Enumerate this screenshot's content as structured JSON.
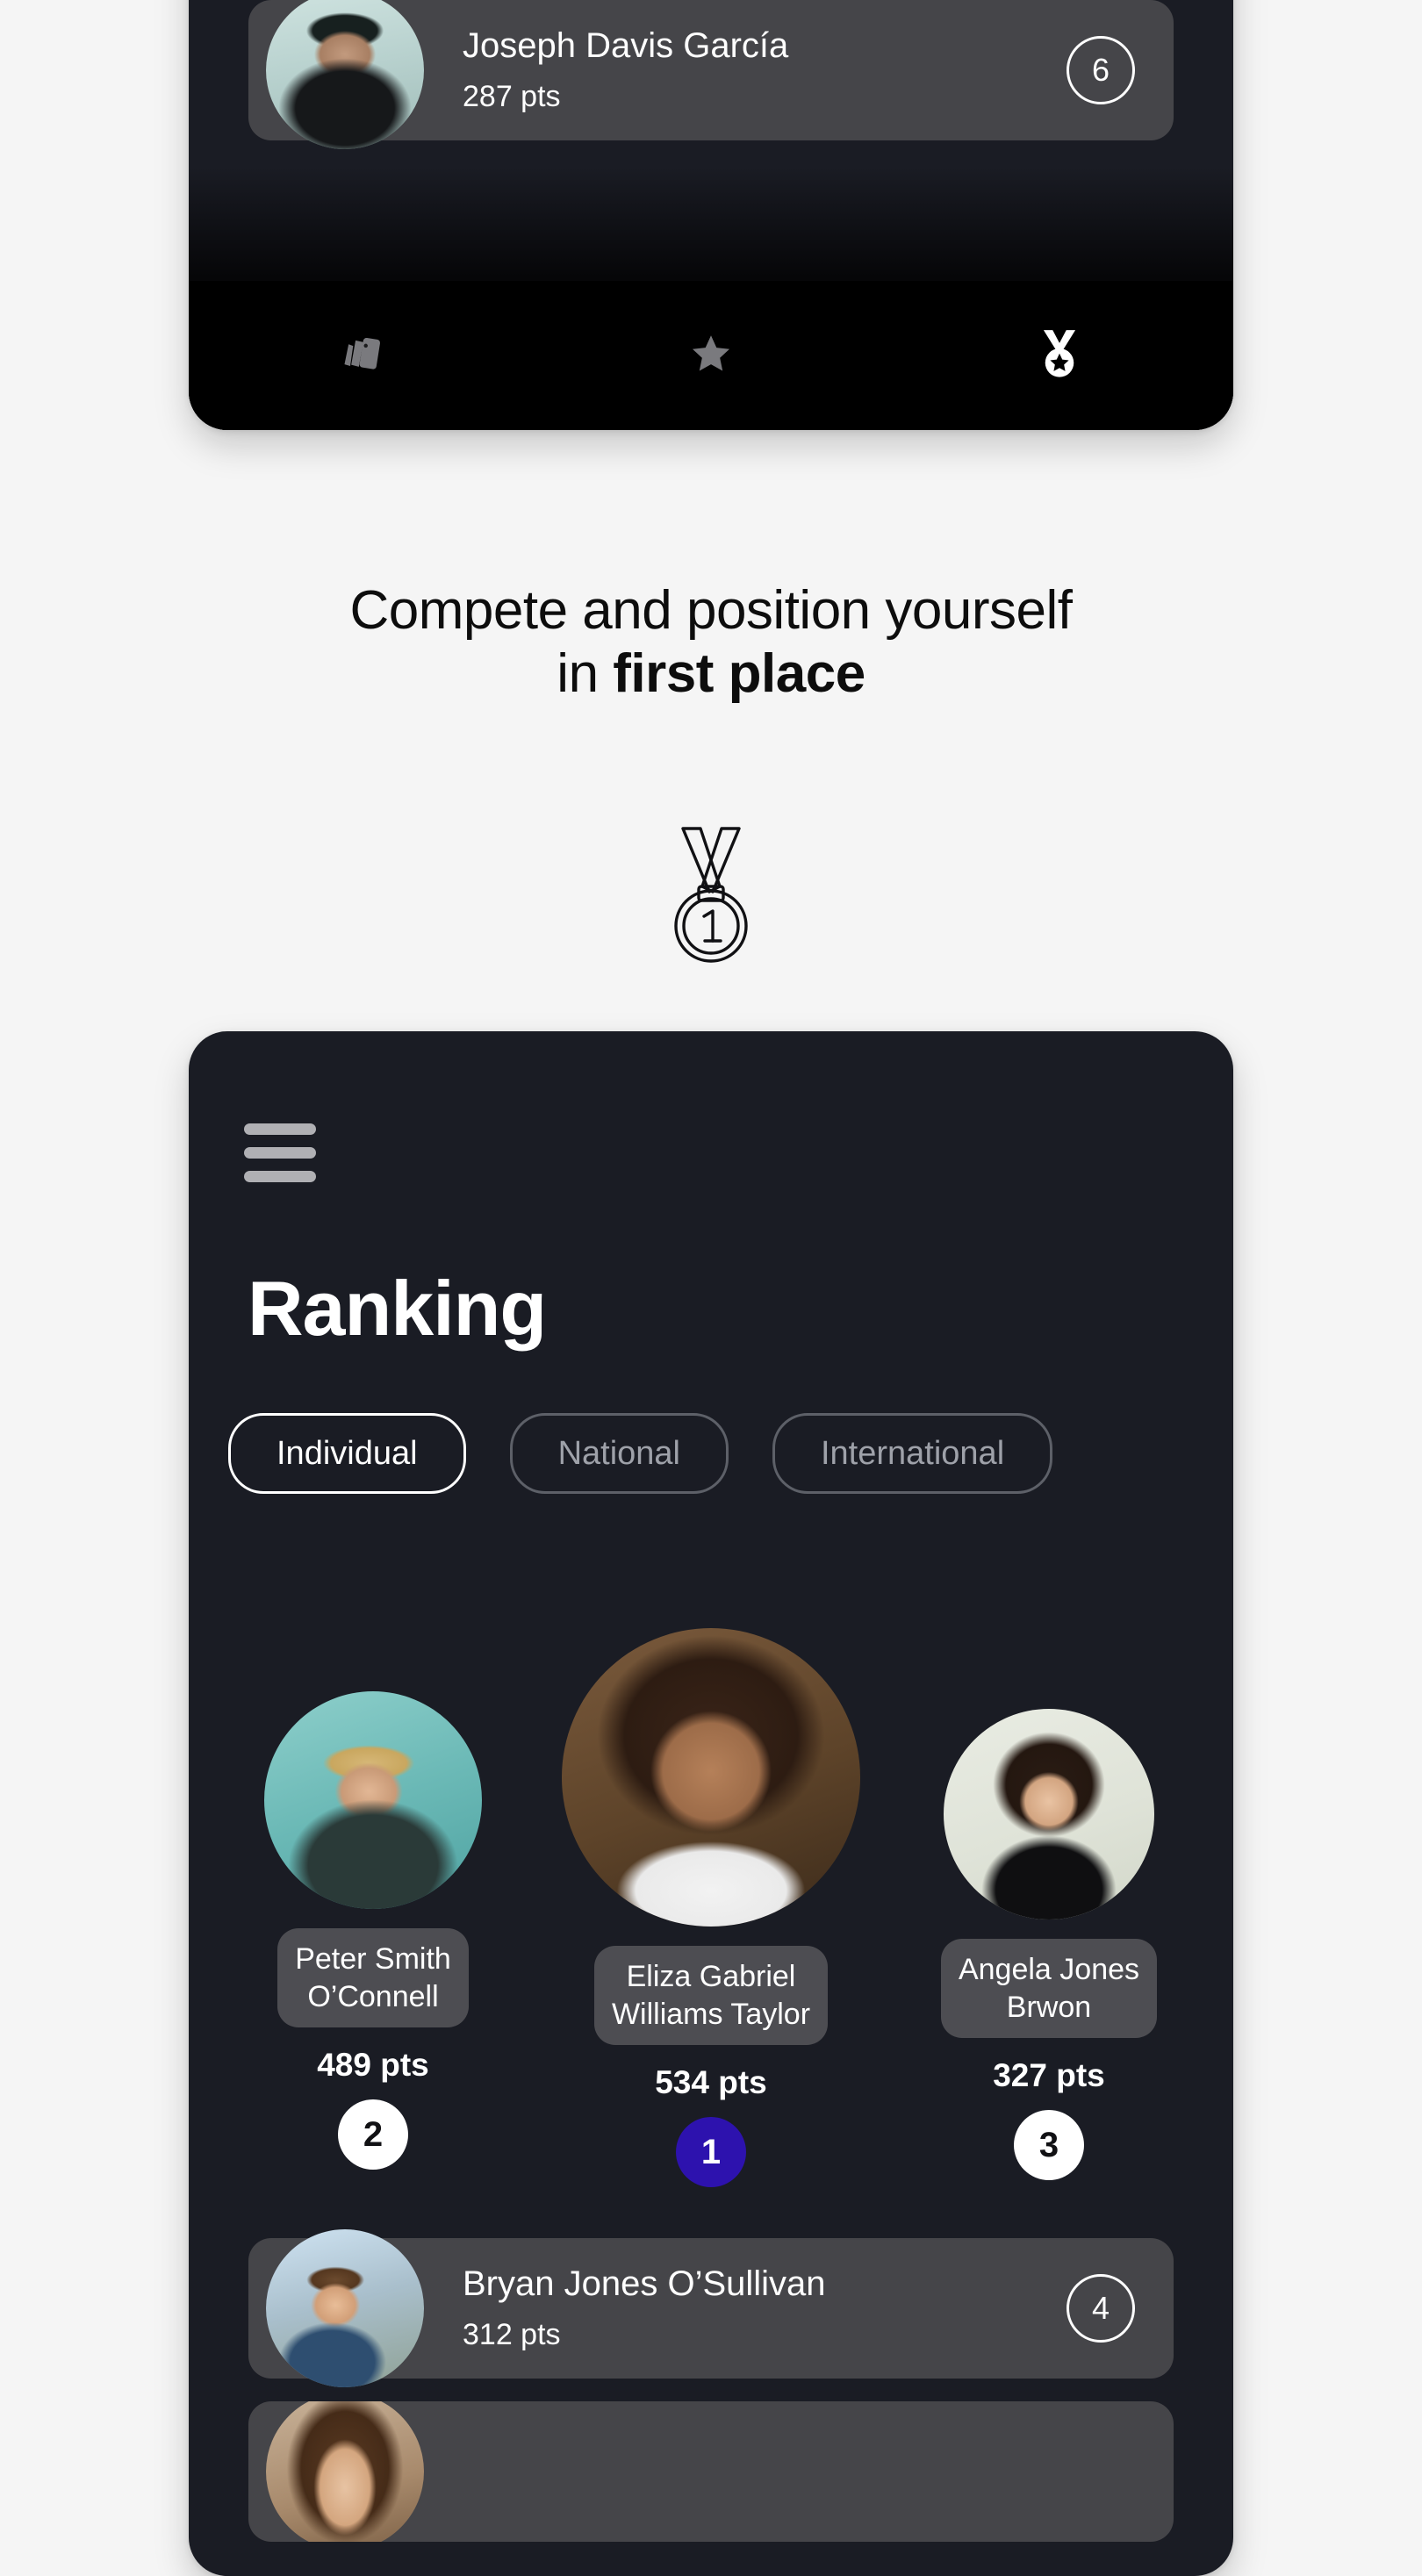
{
  "theme": {
    "page_bg": "#f5f5f5",
    "phone_bg": "#1a1c24",
    "card_bg": "#454549",
    "accent_gold_badge": "#2d12ae",
    "text_primary": "#ffffff",
    "text_muted": "#9ea1a9"
  },
  "top_phone": {
    "partial_row": {
      "name": "Joseph Davis García",
      "points": "287 pts",
      "rank": "6",
      "avatar": "joseph-avatar"
    },
    "tabbar": [
      {
        "icon": "cards-stack-icon",
        "label": "Cards",
        "active": false
      },
      {
        "icon": "star-icon",
        "label": "Favourites",
        "active": false
      },
      {
        "icon": "medal-icon",
        "label": "Ranking",
        "active": true
      }
    ]
  },
  "headline": {
    "line1": "Compete and position yourself",
    "line2_prefix": "in ",
    "line2_bold": "first place",
    "illustration": "medal-one-outline-icon"
  },
  "bottom_phone": {
    "menu_icon": "hamburger-menu-icon",
    "title": "Ranking",
    "chips": [
      {
        "label": "Individual",
        "active": true
      },
      {
        "label": "National",
        "active": false
      },
      {
        "label": "International",
        "active": false
      }
    ],
    "podium": [
      {
        "place": "2",
        "name": "Peter Smith\nO’Connell",
        "name_line1": "Peter Smith",
        "name_line2": "O’Connell",
        "points": "489 pts",
        "avatar": "peter-avatar",
        "badge_style": "silver"
      },
      {
        "place": "1",
        "name_line1": "Eliza Gabriel",
        "name_line2": "Williams Taylor",
        "points": "534 pts",
        "avatar": "eliza-avatar",
        "badge_style": "gold"
      },
      {
        "place": "3",
        "name_line1": "Angela Jones",
        "name_line2": "Brwon",
        "points": "327 pts",
        "avatar": "angela-avatar",
        "badge_style": "bronze"
      }
    ],
    "list": [
      {
        "name": "Bryan Jones O’Sullivan",
        "points": "312 pts",
        "rank": "4",
        "avatar": "bryan-avatar"
      }
    ]
  }
}
